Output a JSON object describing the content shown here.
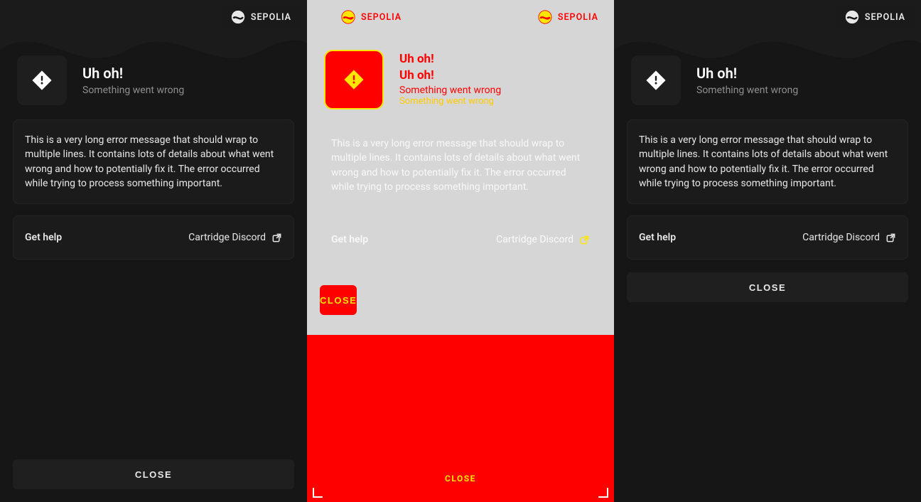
{
  "network": {
    "name": "SEPOLIA"
  },
  "header": {
    "title": "Uh oh!",
    "subtitle": "Something went wrong"
  },
  "error": {
    "message": "This is a very long error message that should wrap to multiple lines. It contains lots of details about what went wrong and how to potentially fix it. The error occurred while trying to process something important."
  },
  "help": {
    "label": "Get help",
    "link_text": "Cartridge Discord"
  },
  "actions": {
    "close_label": "CLOSE"
  }
}
